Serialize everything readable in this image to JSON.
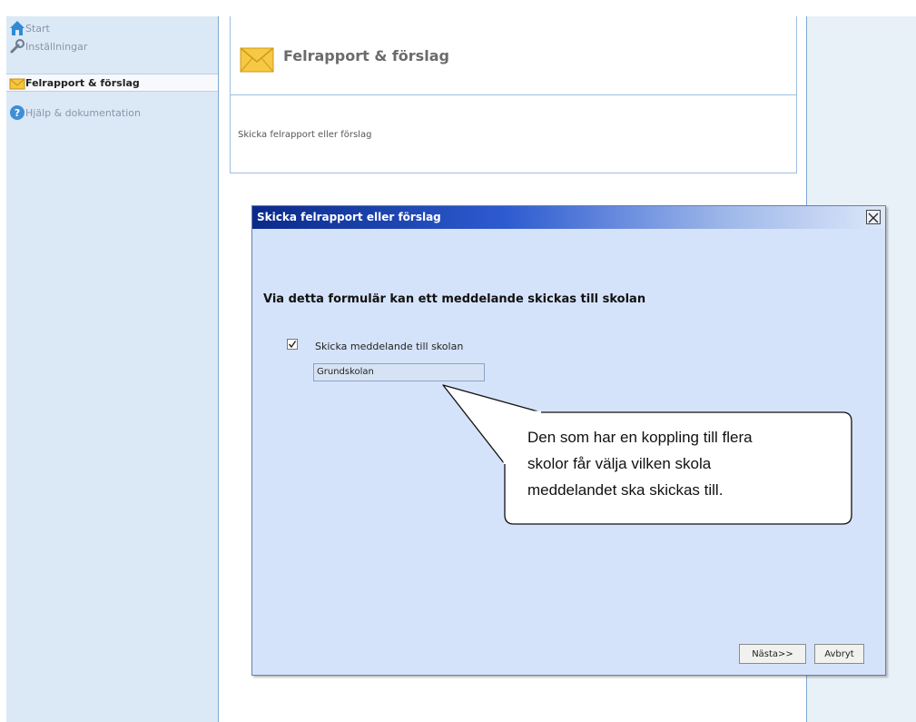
{
  "sidebar": {
    "items": [
      {
        "label": "Start",
        "icon": "home-icon"
      },
      {
        "label": "Inställningar",
        "icon": "wrench-icon"
      },
      {
        "label": "Felrapport & förslag",
        "icon": "envelope-icon"
      },
      {
        "label": "Hjälp & dokumentation",
        "icon": "help-icon"
      }
    ],
    "active_index": 2
  },
  "header": {
    "title": "Felrapport & förslag",
    "icon": "envelope-icon"
  },
  "content": {
    "description": "Skicka felrapport eller förslag"
  },
  "dialog": {
    "title": "Skicka felrapport eller förslag",
    "heading": "Via detta formulär kan ett meddelande skickas till skolan",
    "checkbox_label": "Skicka meddelande till skolan",
    "checkbox_checked": true,
    "school_value": "Grundskolan",
    "next_label": "Nästa>>",
    "cancel_label": "Avbryt"
  },
  "callout": {
    "line1": "Den som har en koppling till flera",
    "line2": "skolor får välja vilken skola",
    "line3": "meddelandet ska skickas till."
  },
  "colors": {
    "sidebar_bg": "#dbe8f6",
    "dialog_bg": "#d5e3fa",
    "titlebar_start": "#0a2a8a"
  }
}
